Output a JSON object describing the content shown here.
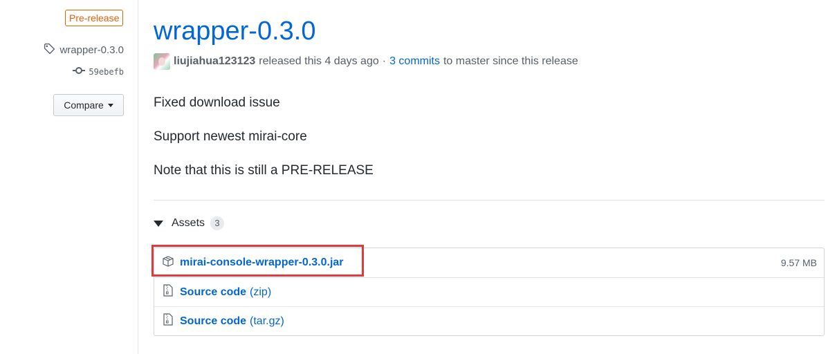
{
  "sidebar": {
    "badge": "Pre-release",
    "tag": {
      "icon": "tag-icon",
      "label": "wrapper-0.3.0"
    },
    "commit": {
      "icon": "commit-icon",
      "sha": "59ebefb"
    },
    "compare_button": "Compare"
  },
  "release": {
    "title": "wrapper-0.3.0",
    "author": "liujiahua123123",
    "released_text": "released this 4 days ago",
    "separator": "·",
    "commits_link": "3 commits",
    "commits_suffix": "to master since this release",
    "notes": [
      "Fixed download issue",
      "Support newest mirai-core",
      "Note that this is still a PRE-RELEASE"
    ]
  },
  "assets": {
    "label": "Assets",
    "count": "3",
    "items": [
      {
        "icon": "package-icon",
        "name": "mirai-console-wrapper-0.3.0.jar",
        "ext": "",
        "size": "9.57 MB"
      },
      {
        "icon": "file-zip-icon",
        "name": "Source code",
        "ext": "(zip)",
        "size": ""
      },
      {
        "icon": "file-zip-icon",
        "name": "Source code",
        "ext": "(tar.gz)",
        "size": ""
      }
    ]
  },
  "colors": {
    "link": "#0366d6",
    "prerelease": "#e36209",
    "highlight": "#e0393e"
  }
}
